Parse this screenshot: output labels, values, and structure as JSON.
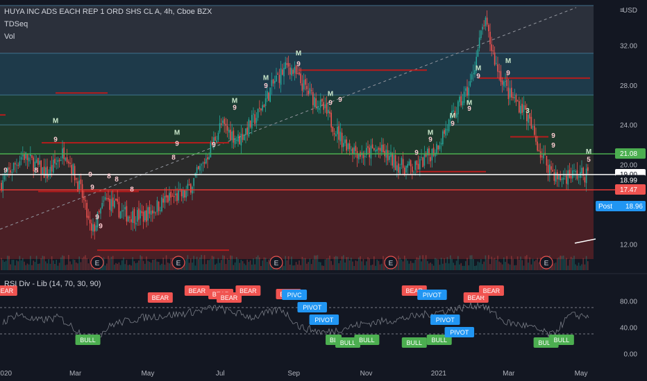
{
  "header": {
    "symbol_line": "HUYA INC ADS EACH REP 1 ORD SHS CL A, 4h, Cboe BZX",
    "indicator_1": "TDSeq",
    "indicator_2": "Vol"
  },
  "rsi_panel": {
    "title": "RSI Div - Lib (14, 70, 30, 90)",
    "ticks": [
      "80.00",
      "40.00",
      "0.00"
    ]
  },
  "colors": {
    "background": "#131722",
    "up_candle": "#26a69a",
    "down_candle": "#ef5350",
    "bull_tag": "#4caf50",
    "bear_tag": "#f05451",
    "pivot_tag": "#2196f3",
    "support_line": "#e53935",
    "resistance_line": "#4caf50",
    "last_price_line": "#ffffff"
  },
  "price_scale": {
    "currency": "USD",
    "ticks": [
      "32.00",
      "28.00",
      "24.00",
      "20.00",
      "12.00"
    ],
    "labels": [
      {
        "text": "21.08",
        "bg": "#4caf50",
        "fg": "#ffffff"
      },
      {
        "text": "19.00",
        "bg": "#ffffff",
        "fg": "#131722"
      },
      {
        "text": "18.99",
        "bg": "#131722",
        "fg": "#ffffff"
      },
      {
        "text": "17.47",
        "bg": "#ef5350",
        "fg": "#ffffff"
      }
    ],
    "post_label": {
      "tag": "Post",
      "value": "18.96",
      "bg": "#2196f3"
    }
  },
  "time_axis": [
    "2020",
    "Mar",
    "May",
    "Jul",
    "Sep",
    "Nov",
    "2021",
    "Mar",
    "May"
  ],
  "events": [
    "E",
    "E",
    "E",
    "E",
    "E"
  ],
  "markers": {
    "bull": "BULL",
    "bear": "BEAR",
    "pivot": "PIVOT",
    "pivot_short": "PIVC",
    "bull_short": "BL",
    "td": [
      "9",
      "8",
      "M",
      "5",
      "3"
    ]
  },
  "chart_data": {
    "type": "candlestick",
    "title": "HUYA INC ADS EACH REP 1 ORD SHS CL A, 4h, Cboe BZX",
    "x_range": [
      "2020-01-01",
      "2021-05-15"
    ],
    "y_range": [
      10.5,
      36
    ],
    "last_price": 19.0,
    "post_price": 18.96,
    "levels": [
      {
        "value": 21.08,
        "kind": "resistance"
      },
      {
        "value": 19.0,
        "kind": "last"
      },
      {
        "value": 17.47,
        "kind": "support"
      }
    ],
    "price_path": [
      {
        "t": "2020-01-01",
        "p": 18.0
      },
      {
        "t": "2020-01-20",
        "p": 21.0
      },
      {
        "t": "2020-02-10",
        "p": 19.0
      },
      {
        "t": "2020-02-25",
        "p": 21.5
      },
      {
        "t": "2020-03-10",
        "p": 17.0
      },
      {
        "t": "2020-03-18",
        "p": 13.0
      },
      {
        "t": "2020-03-30",
        "p": 16.5
      },
      {
        "t": "2020-04-15",
        "p": 15.0
      },
      {
        "t": "2020-05-01",
        "p": 14.8
      },
      {
        "t": "2020-05-20",
        "p": 16.5
      },
      {
        "t": "2020-06-05",
        "p": 17.0
      },
      {
        "t": "2020-06-20",
        "p": 20.0
      },
      {
        "t": "2020-07-05",
        "p": 24.0
      },
      {
        "t": "2020-07-20",
        "p": 22.5
      },
      {
        "t": "2020-08-05",
        "p": 25.0
      },
      {
        "t": "2020-08-20",
        "p": 28.5
      },
      {
        "t": "2020-08-31",
        "p": 30.0
      },
      {
        "t": "2020-09-15",
        "p": 27.5
      },
      {
        "t": "2020-09-30",
        "p": 25.5
      },
      {
        "t": "2020-10-15",
        "p": 22.5
      },
      {
        "t": "2020-11-01",
        "p": 21.0
      },
      {
        "t": "2020-11-15",
        "p": 21.5
      },
      {
        "t": "2020-12-01",
        "p": 20.0
      },
      {
        "t": "2020-12-15",
        "p": 19.5
      },
      {
        "t": "2021-01-01",
        "p": 21.5
      },
      {
        "t": "2021-01-15",
        "p": 24.5
      },
      {
        "t": "2021-01-31",
        "p": 28.0
      },
      {
        "t": "2021-02-12",
        "p": 34.5
      },
      {
        "t": "2021-02-22",
        "p": 30.0
      },
      {
        "t": "2021-03-05",
        "p": 27.0
      },
      {
        "t": "2021-03-18",
        "p": 25.5
      },
      {
        "t": "2021-04-01",
        "p": 21.0
      },
      {
        "t": "2021-04-15",
        "p": 18.5
      },
      {
        "t": "2021-04-25",
        "p": 19.0
      }
    ],
    "rsi_range": [
      -12,
      112
    ],
    "rsi_levels": [
      70,
      30
    ],
    "rsi_path": [
      {
        "t": "2020-01-01",
        "v": 45
      },
      {
        "t": "2020-01-15",
        "v": 60
      },
      {
        "t": "2020-02-01",
        "v": 50
      },
      {
        "t": "2020-02-20",
        "v": 55
      },
      {
        "t": "2020-03-10",
        "v": 30
      },
      {
        "t": "2020-03-20",
        "v": 22
      },
      {
        "t": "2020-04-05",
        "v": 45
      },
      {
        "t": "2020-05-01",
        "v": 55
      },
      {
        "t": "2020-06-01",
        "v": 60
      },
      {
        "t": "2020-07-01",
        "v": 70
      },
      {
        "t": "2020-08-01",
        "v": 55
      },
      {
        "t": "2020-08-25",
        "v": 68
      },
      {
        "t": "2020-09-10",
        "v": 40
      },
      {
        "t": "2020-10-01",
        "v": 32
      },
      {
        "t": "2020-11-01",
        "v": 45
      },
      {
        "t": "2020-12-01",
        "v": 52
      },
      {
        "t": "2021-01-01",
        "v": 62
      },
      {
        "t": "2021-02-10",
        "v": 75
      },
      {
        "t": "2021-03-01",
        "v": 48
      },
      {
        "t": "2021-03-20",
        "v": 42
      },
      {
        "t": "2021-04-10",
        "v": 28
      },
      {
        "t": "2021-04-25",
        "v": 58
      }
    ],
    "divergence_tags": [
      {
        "t": "2020-01-05",
        "label": "BEAR",
        "kind": "bear"
      },
      {
        "t": "2020-03-15",
        "label": "BULL",
        "kind": "bull"
      },
      {
        "t": "2020-05-15",
        "label": "BEAR",
        "kind": "bear"
      },
      {
        "t": "2020-06-15",
        "label": "BEAR",
        "kind": "bear"
      },
      {
        "t": "2020-07-05",
        "label": "BEAR",
        "kind": "bear"
      },
      {
        "t": "2020-07-12",
        "label": "BEAR",
        "kind": "bear"
      },
      {
        "t": "2020-07-28",
        "label": "BEAR",
        "kind": "bear"
      },
      {
        "t": "2020-08-31",
        "label": "BEAR",
        "kind": "bear"
      },
      {
        "t": "2020-09-05",
        "label": "PIVC",
        "kind": "pivot"
      },
      {
        "t": "2020-09-20",
        "label": "PIVOT",
        "kind": "pivot"
      },
      {
        "t": "2020-09-30",
        "label": "PIVOT",
        "kind": "pivot"
      },
      {
        "t": "2020-10-08",
        "label": "BL",
        "kind": "bull"
      },
      {
        "t": "2020-10-20",
        "label": "BULL",
        "kind": "bull"
      },
      {
        "t": "2020-11-05",
        "label": "BULL",
        "kind": "bull"
      },
      {
        "t": "2020-12-15",
        "label": "BULL",
        "kind": "bull"
      },
      {
        "t": "2020-12-15",
        "label": "BEAR",
        "kind": "bear"
      },
      {
        "t": "2020-12-30",
        "label": "PIVOT",
        "kind": "pivot"
      },
      {
        "t": "2021-01-05",
        "label": "BULL",
        "kind": "bull"
      },
      {
        "t": "2021-01-10",
        "label": "PIVOT",
        "kind": "pivot"
      },
      {
        "t": "2021-01-22",
        "label": "PIVOT",
        "kind": "pivot"
      },
      {
        "t": "2021-02-05",
        "label": "BEAR",
        "kind": "bear"
      },
      {
        "t": "2021-02-18",
        "label": "BEAR",
        "kind": "bear"
      },
      {
        "t": "2021-04-05",
        "label": "BULL",
        "kind": "bull"
      },
      {
        "t": "2021-04-18",
        "label": "BULL",
        "kind": "bull"
      }
    ]
  }
}
